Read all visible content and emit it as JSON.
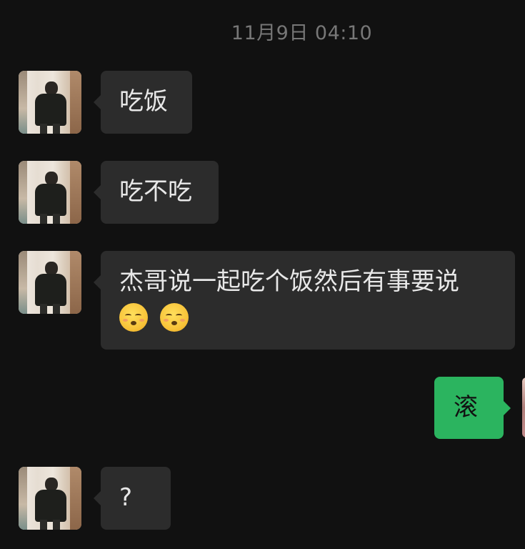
{
  "chat": {
    "timestamp": "11月9日 04:10",
    "messages": [
      {
        "side": "in",
        "text": "吃饭"
      },
      {
        "side": "in",
        "text": "吃不吃"
      },
      {
        "side": "in",
        "text": "杰哥说一起吃个饭然后有事要说",
        "emojis": [
          "hushed-face-emoji",
          "hushed-face-emoji"
        ]
      },
      {
        "side": "out",
        "text": "滚"
      },
      {
        "side": "in",
        "text": "?"
      }
    ]
  },
  "colors": {
    "background": "#111111",
    "incoming_bubble": "#2c2c2c",
    "outgoing_bubble": "#2bb45f",
    "timestamp_text": "#777777"
  }
}
